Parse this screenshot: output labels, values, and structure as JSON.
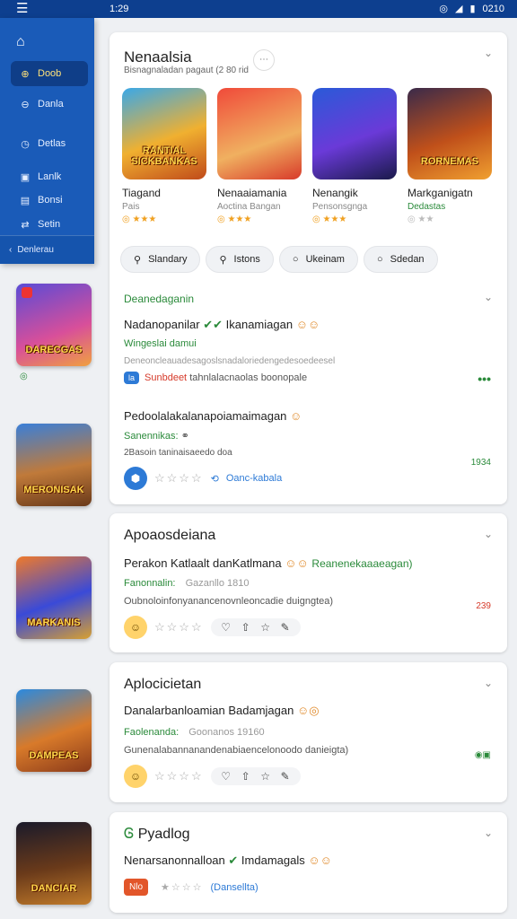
{
  "status": {
    "time": "1:29",
    "right_text": "0210"
  },
  "drawer": {
    "items": [
      {
        "label": "Doob",
        "active": true
      },
      {
        "label": "Danla",
        "active": false
      },
      {
        "label": "Detlas",
        "active": false
      },
      {
        "label": "Lanlk",
        "active": false
      },
      {
        "label": "Bonsi",
        "active": false
      },
      {
        "label": "Setin",
        "active": false
      }
    ],
    "footer": "Denlerau"
  },
  "side_thumbs": [
    {
      "label": "DARECGAS"
    },
    {
      "label": "MERONISAK"
    },
    {
      "label": "MARKANIS"
    },
    {
      "label": "DAMPEAS"
    },
    {
      "label": "DANCIAR"
    }
  ],
  "card1": {
    "title": "Nenaalsia",
    "subtitle": "Bisnagnaladan pagaut (2 80 rid",
    "games": [
      {
        "art": "RANTIAL SICKBANKAS",
        "name": "Tiagand",
        "dev": "Pais",
        "dev_green": false
      },
      {
        "art": "",
        "name": "Nenaaiamania",
        "dev": "Aoctina Bangan",
        "dev_green": false
      },
      {
        "art": "",
        "name": "Nenangik",
        "dev": "Pensonsgnga",
        "dev_green": false
      },
      {
        "art": "RORNEMAS",
        "name": "Markganigatn",
        "dev": "Dedastas",
        "dev_green": true
      }
    ],
    "filters": [
      {
        "label": "Slandary",
        "icon": "search"
      },
      {
        "label": "Istons",
        "icon": "search"
      },
      {
        "label": "Ukeinam",
        "icon": "circle"
      },
      {
        "label": "Sdedan",
        "icon": "circle"
      }
    ],
    "section_head": "Deanedaganin",
    "item1": {
      "title": "Nadanopanilar",
      "title2": "Ikanamiagan",
      "green": "Wingeslai  damui",
      "gray": "Deneoncleauadesagoslsnadaloriedengedesoedeesel",
      "tag": "la",
      "note_red": "Sunbdeet",
      "note": "tahnlalacnaolas  boonopale"
    },
    "item2": {
      "title": "Pedoolalakalanapoiamaimagan",
      "green": "Sanennikas:",
      "gray": "2Basoin taninaisaeedo doa",
      "link": "Oanc-kabala",
      "badge": "1934"
    }
  },
  "card2": {
    "title": "Apoaosdeiana",
    "line": "Perakon Katlaalt danKatlmana",
    "line_green": "Reanenekaaaeagan)",
    "green": "Fanonnalin:",
    "green_gray": "Gazanllo 1810",
    "note": "Oubnoloinfonyanancenovnleoncadie duigngtea)",
    "badge": "239"
  },
  "card3": {
    "title": "Aplocicietan",
    "line": "Danalarbanloamian Badamjagan",
    "green": "Faolenanda:",
    "green_gray": "Goonanos 19160",
    "note": "Gunenalabannanandenabiaencelonoodo danieigta)"
  },
  "card4": {
    "title": "Pyadlog",
    "line": "Nenarsanonnalloan",
    "line2": "Imdamagals",
    "tag": "Nlo",
    "link": "(Dansellta)"
  }
}
